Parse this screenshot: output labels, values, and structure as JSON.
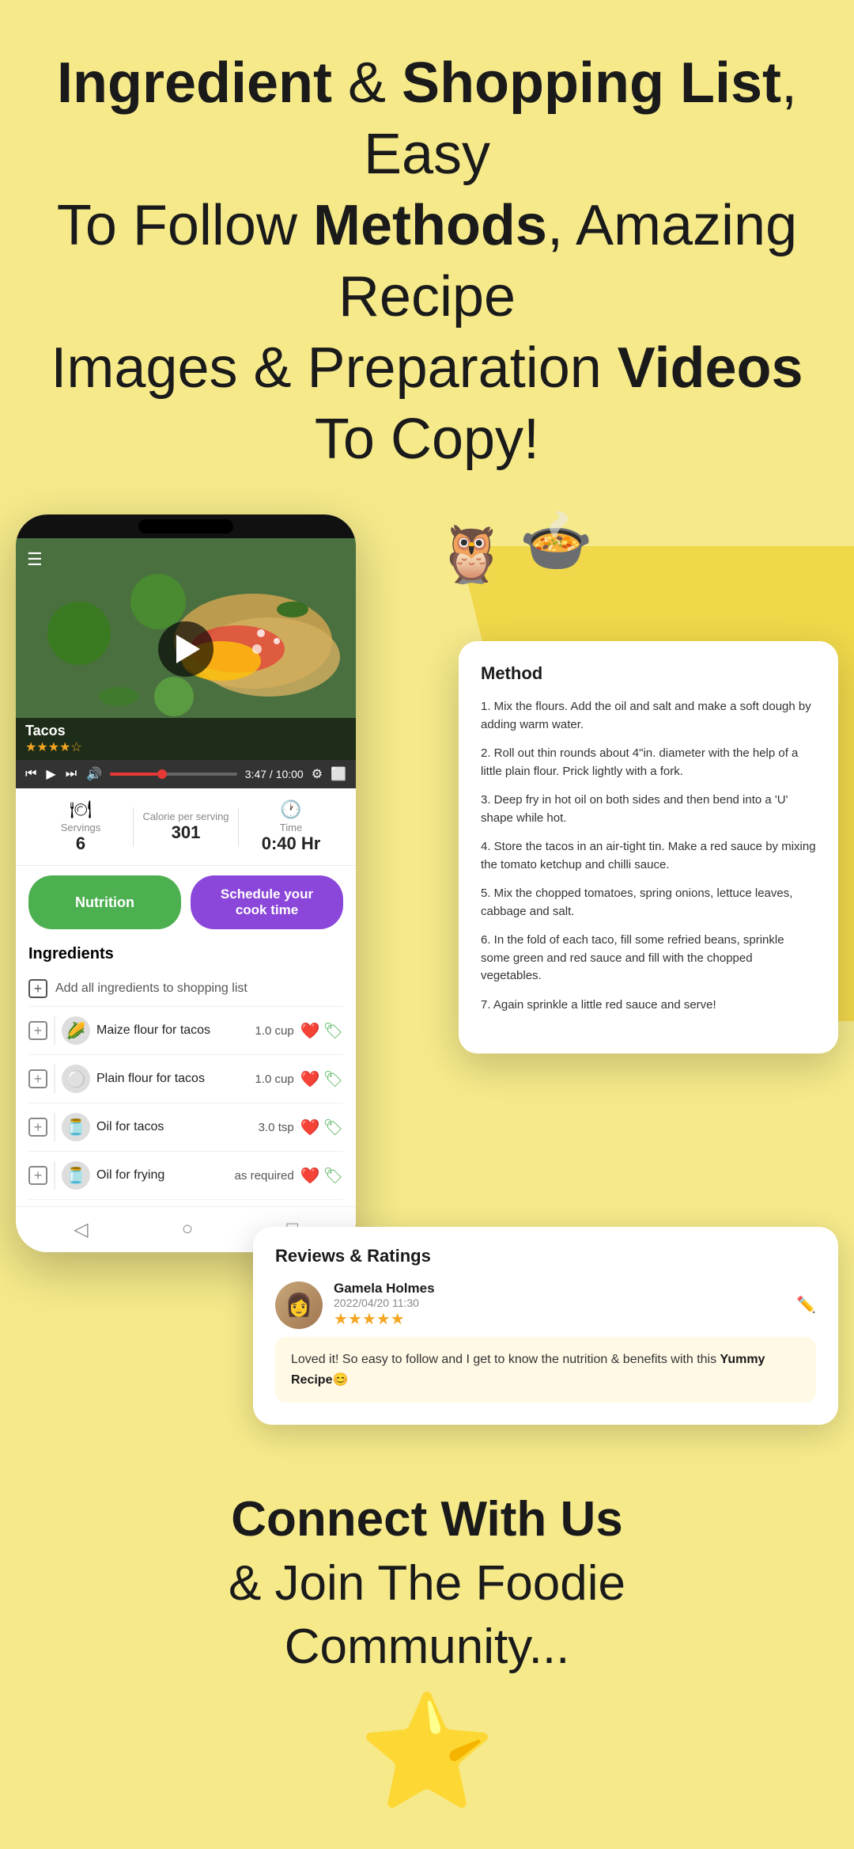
{
  "header": {
    "line1": "Ingredient & Shopping List, Easy",
    "line2": "To Follow Methods, Amazing Recipe",
    "line3": "Images & Preparation Videos To Copy!"
  },
  "video": {
    "title": "Tacos",
    "time_current": "3:47",
    "time_total": "10:00",
    "stars": "★★★★☆"
  },
  "info_bar": {
    "servings_label": "Servings",
    "servings_value": "6",
    "calories_label": "Calorie per serving",
    "calories_value": "301",
    "time_label": "Time",
    "time_value": "0:40 Hr"
  },
  "buttons": {
    "nutrition": "Nutrition",
    "schedule": "Schedule your cook time"
  },
  "ingredients": {
    "section_title": "Ingredients",
    "add_all": "Add all ingredients to shopping list",
    "items": [
      {
        "name": "Maize flour for tacos",
        "amount": "1.0 cup",
        "emoji": "🌽"
      },
      {
        "name": "Plain flour for tacos",
        "amount": "1.0 cup",
        "emoji": "⚪"
      },
      {
        "name": "Oil for tacos",
        "amount": "3.0 tsp",
        "emoji": "🫙"
      },
      {
        "name": "Oil for frying",
        "amount": "as required",
        "emoji": "🫙"
      }
    ]
  },
  "method": {
    "title": "Method",
    "steps": [
      "1. Mix the flours. Add the oil and salt and make a soft dough by adding warm water.",
      "2. Roll out thin rounds about 4\"in. diameter with the help of a little plain flour. Prick lightly with a fork.",
      "3. Deep fry in hot oil on both sides and then bend into a 'U' shape while hot.",
      "4. Store the tacos in an air-tight tin. Make a red sauce by mixing the tomato ketchup and chilli sauce.",
      "5. Mix the chopped tomatoes, spring onions, lettuce leaves, cabbage and salt.",
      "6. In the fold of each taco, fill some refried beans, sprinkle some green and red sauce and fill with the chopped vegetables.",
      "7. Again sprinkle a little red sauce and serve!"
    ]
  },
  "reviews": {
    "title": "Reviews & Ratings",
    "reviewer": {
      "name": "Gamela Holmes",
      "date": "2022/04/20 11:30",
      "stars": "★★★★★",
      "star_empty": "☆"
    },
    "review_text": "Loved it!\nSo easy to follow and I get to know the nutrition & benefits with this ",
    "review_bold": "Yummy Recipe😊"
  },
  "footer": {
    "line1": "Connect With Us",
    "line2": "& Join The Foodie",
    "line3": "Community...",
    "star_emoji": "⭐"
  }
}
